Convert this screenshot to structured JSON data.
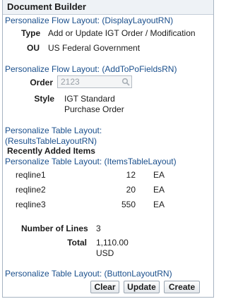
{
  "title": "Document Builder",
  "sections": {
    "flow_layout_link": "Personalize Flow Layout: (DisplayLayoutRN)",
    "type_label": "Type",
    "type_value": "Add or Update IGT Order / Modification",
    "ou_label": "OU",
    "ou_value": "US Federal Government",
    "addtopo_link": "Personalize Flow Layout: (AddToPoFieldsRN)",
    "order_label": "Order",
    "order_value": "2123",
    "style_label": "Style",
    "style_value_line1": "IGT Standard",
    "style_value_line2": "Purchase Order",
    "results_link_line1": "Personalize Table Layout:",
    "results_link_line2": "(ResultsTableLayoutRN)",
    "recently_added": "Recently Added Items",
    "items_link": "Personalize Table Layout: (ItemsTableLayout)"
  },
  "items": [
    {
      "line": "reqline1",
      "qty": "12",
      "uom": "EA"
    },
    {
      "line": "reqline2",
      "qty": "20",
      "uom": "EA"
    },
    {
      "line": "reqline3",
      "qty": "550",
      "uom": "EA"
    }
  ],
  "summary": {
    "lines_label": "Number of Lines",
    "lines_value": "3",
    "total_label": "Total",
    "total_value_line1": "1,110.00",
    "total_value_line2": "USD"
  },
  "button_link": "Personalize Table Layout: (ButtonLayoutRN)",
  "buttons": {
    "clear": "Clear",
    "update": "Update",
    "create": "Create"
  }
}
